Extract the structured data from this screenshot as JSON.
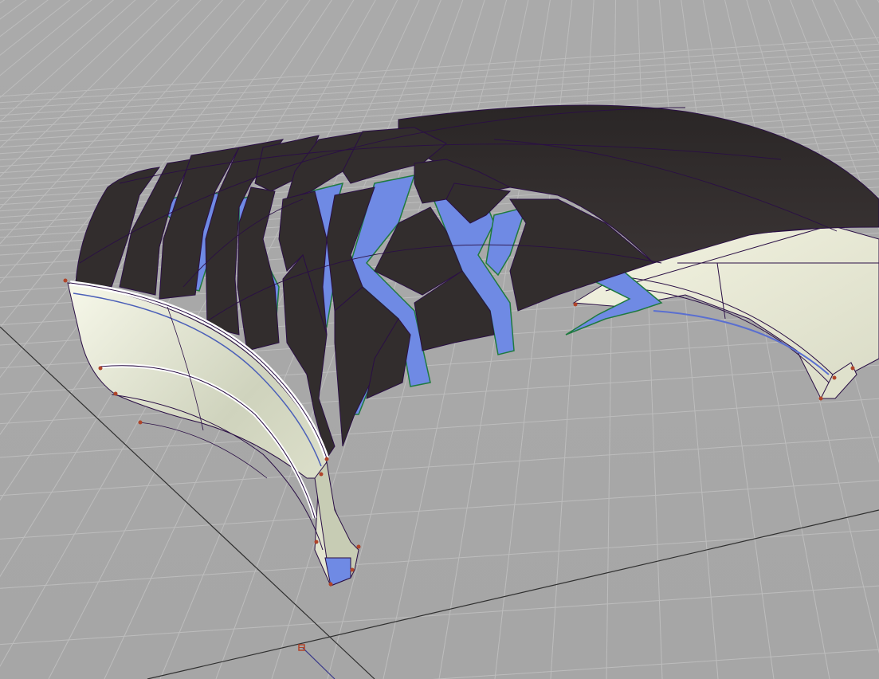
{
  "viewport": {
    "name": "3d-modeling-viewport",
    "background_color": "#a9a9a9",
    "grid_line_color": "#bdbdbd",
    "axis_line_color": "#2f2f2f"
  },
  "model": {
    "name": "tire-tread-section",
    "tread_block_color": "#322d2d",
    "tread_outline_color": "#2a0f45",
    "groove_fill_color": "#6f8ae4",
    "groove_outline_color": "#1f7a3f",
    "sidewall_color": "#e9ecd7",
    "inner_liner_color": "#f5f5e2",
    "control_point_color": "#b0452a"
  },
  "icons": {
    "pivot": "pivot-marker-icon"
  }
}
